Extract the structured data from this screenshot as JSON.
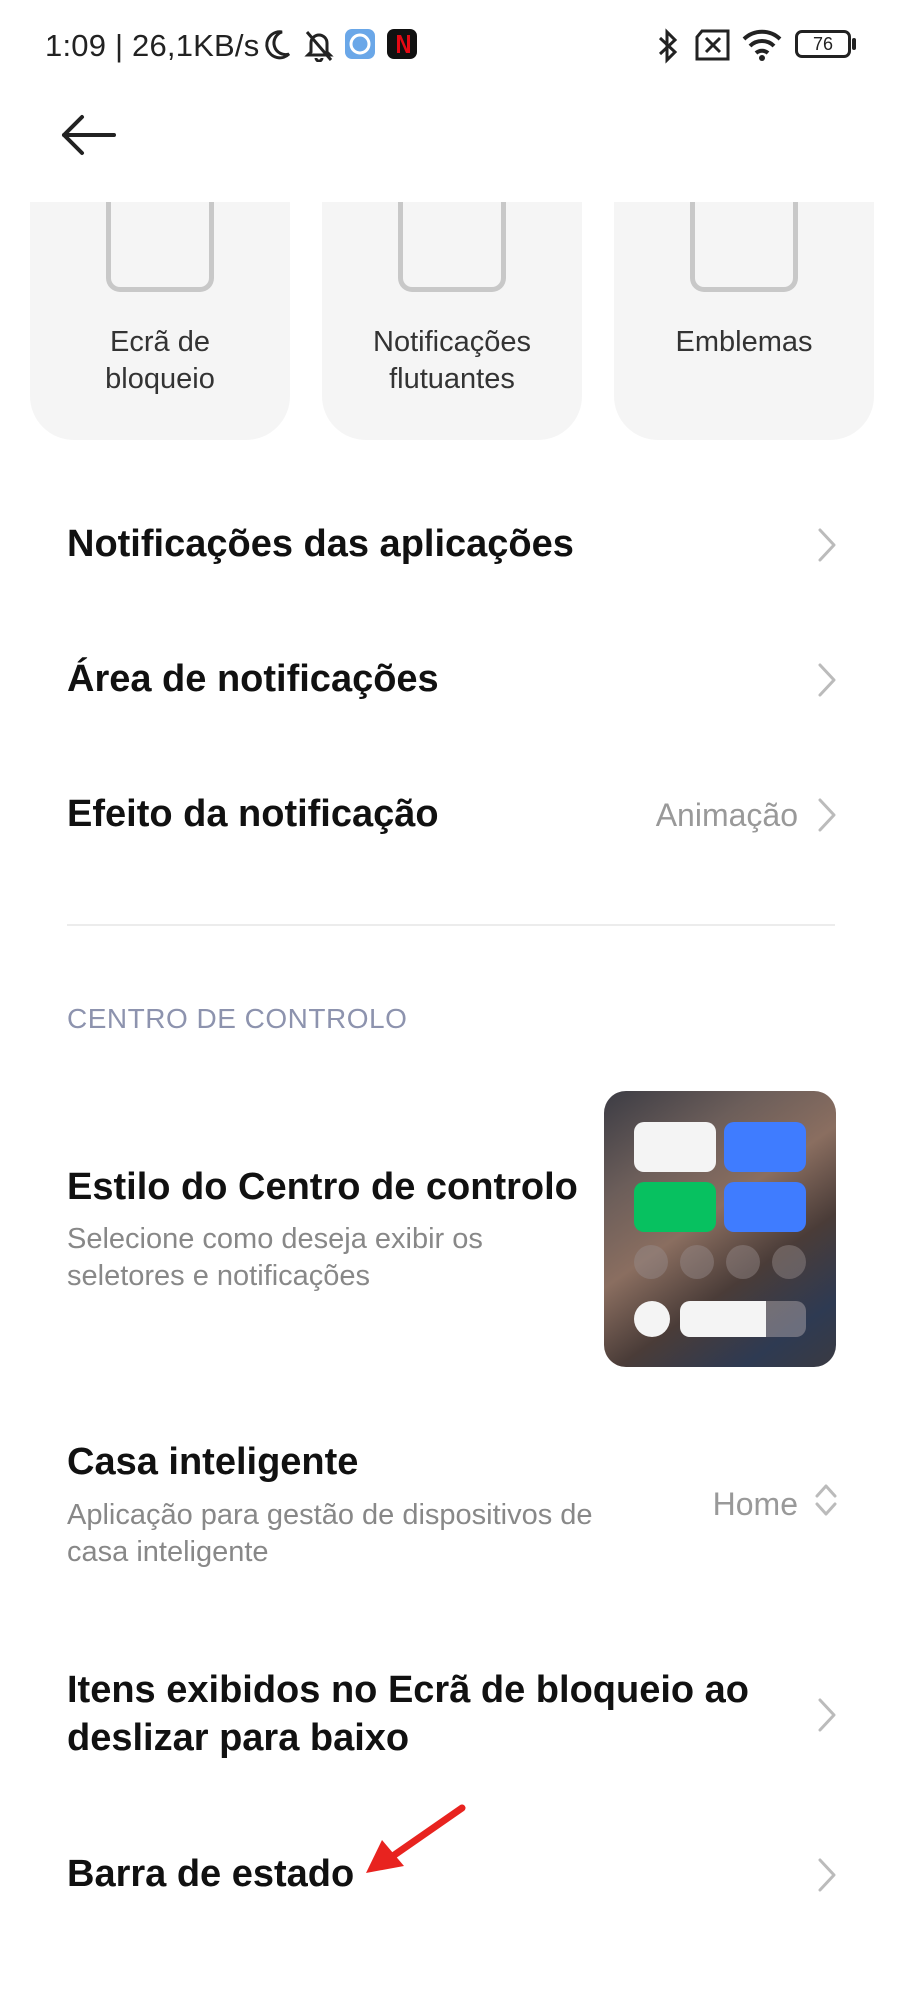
{
  "status_bar": {
    "time_speed": "1:09 | 26,1KB/s",
    "battery": "76"
  },
  "cards": [
    {
      "label_line1": "Ecrã de",
      "label_line2": "bloqueio"
    },
    {
      "label_line1": "Notificações",
      "label_line2": "flutuantes"
    },
    {
      "label_line1": "Emblemas",
      "label_line2": ""
    }
  ],
  "rows": {
    "app_notifications": {
      "title": "Notificações das aplicações"
    },
    "notification_area": {
      "title": "Área de notificações"
    },
    "notification_effect": {
      "title": "Efeito da notificação",
      "value": "Animação"
    }
  },
  "control_center": {
    "header": "CENTRO DE CONTROLO",
    "style": {
      "title": "Estilo do Centro de controlo",
      "subtitle_line1": "Selecione como deseja exibir os",
      "subtitle_line2": "seletores e notificações"
    },
    "smart_home": {
      "title": "Casa inteligente",
      "subtitle_line1": "Aplicação para gestão de dispositivos de",
      "subtitle_line2": "casa inteligente",
      "value": "Home"
    },
    "lockscreen_items": {
      "title_line1": "Itens exibidos no Ecrã de bloqueio ao",
      "title_line2": "deslizar para baixo"
    },
    "status_bar_row": {
      "title": "Barra de estado"
    }
  },
  "colors": {
    "tile_white": "#f4f4f4",
    "tile_blue": "#3f7cff",
    "tile_green": "#07c160",
    "annotation_arrow": "#e8231f",
    "section_header": "#8d93ae"
  }
}
